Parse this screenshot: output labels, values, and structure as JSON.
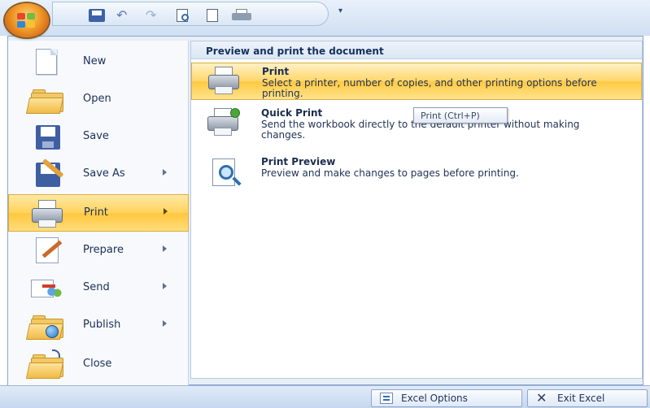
{
  "quick_access": {
    "office_button_icon": "office-logo-icon",
    "icons": [
      "save-icon",
      "undo-icon",
      "redo-icon",
      "print-preview-icon",
      "new-document-icon",
      "quick-print-icon",
      "customize-dropdown-icon"
    ],
    "undo_glyph": "↶",
    "redo_glyph": "↷",
    "more_glyph": "▾"
  },
  "menu": {
    "items": [
      {
        "label": "New",
        "icon": "new-document-icon",
        "has_submenu": false
      },
      {
        "label": "Open",
        "icon": "open-folder-icon",
        "has_submenu": false
      },
      {
        "label": "Save",
        "icon": "save-disk-icon",
        "has_submenu": false
      },
      {
        "label": "Save As",
        "icon": "save-as-icon",
        "has_submenu": true
      },
      {
        "label": "Print",
        "icon": "printer-icon",
        "has_submenu": true,
        "active": true
      },
      {
        "label": "Prepare",
        "icon": "prepare-icon",
        "has_submenu": true
      },
      {
        "label": "Send",
        "icon": "send-icon",
        "has_submenu": true
      },
      {
        "label": "Publish",
        "icon": "publish-icon",
        "has_submenu": true
      },
      {
        "label": "Close",
        "icon": "close-folder-icon",
        "has_submenu": false
      }
    ]
  },
  "print_panel": {
    "header": "Preview and print the document",
    "options": [
      {
        "title": "Print",
        "description": "Select a printer, number of copies, and other printing options before printing.",
        "icon": "printer-icon",
        "active": true
      },
      {
        "title": "Quick Print",
        "description": "Send the workbook directly to the default printer without making changes.",
        "icon": "quick-print-icon"
      },
      {
        "title": "Print Preview",
        "description": "Preview and make changes to pages before printing.",
        "icon": "print-preview-icon"
      }
    ],
    "tooltip": "Print (Ctrl+P)"
  },
  "footer": {
    "options_label": "Excel Options",
    "exit_label": "Exit Excel",
    "exit_glyph": "✕"
  },
  "colors": {
    "highlight": "#ffd25a",
    "text": "#1c2f58",
    "frame": "#8ba6cd"
  }
}
